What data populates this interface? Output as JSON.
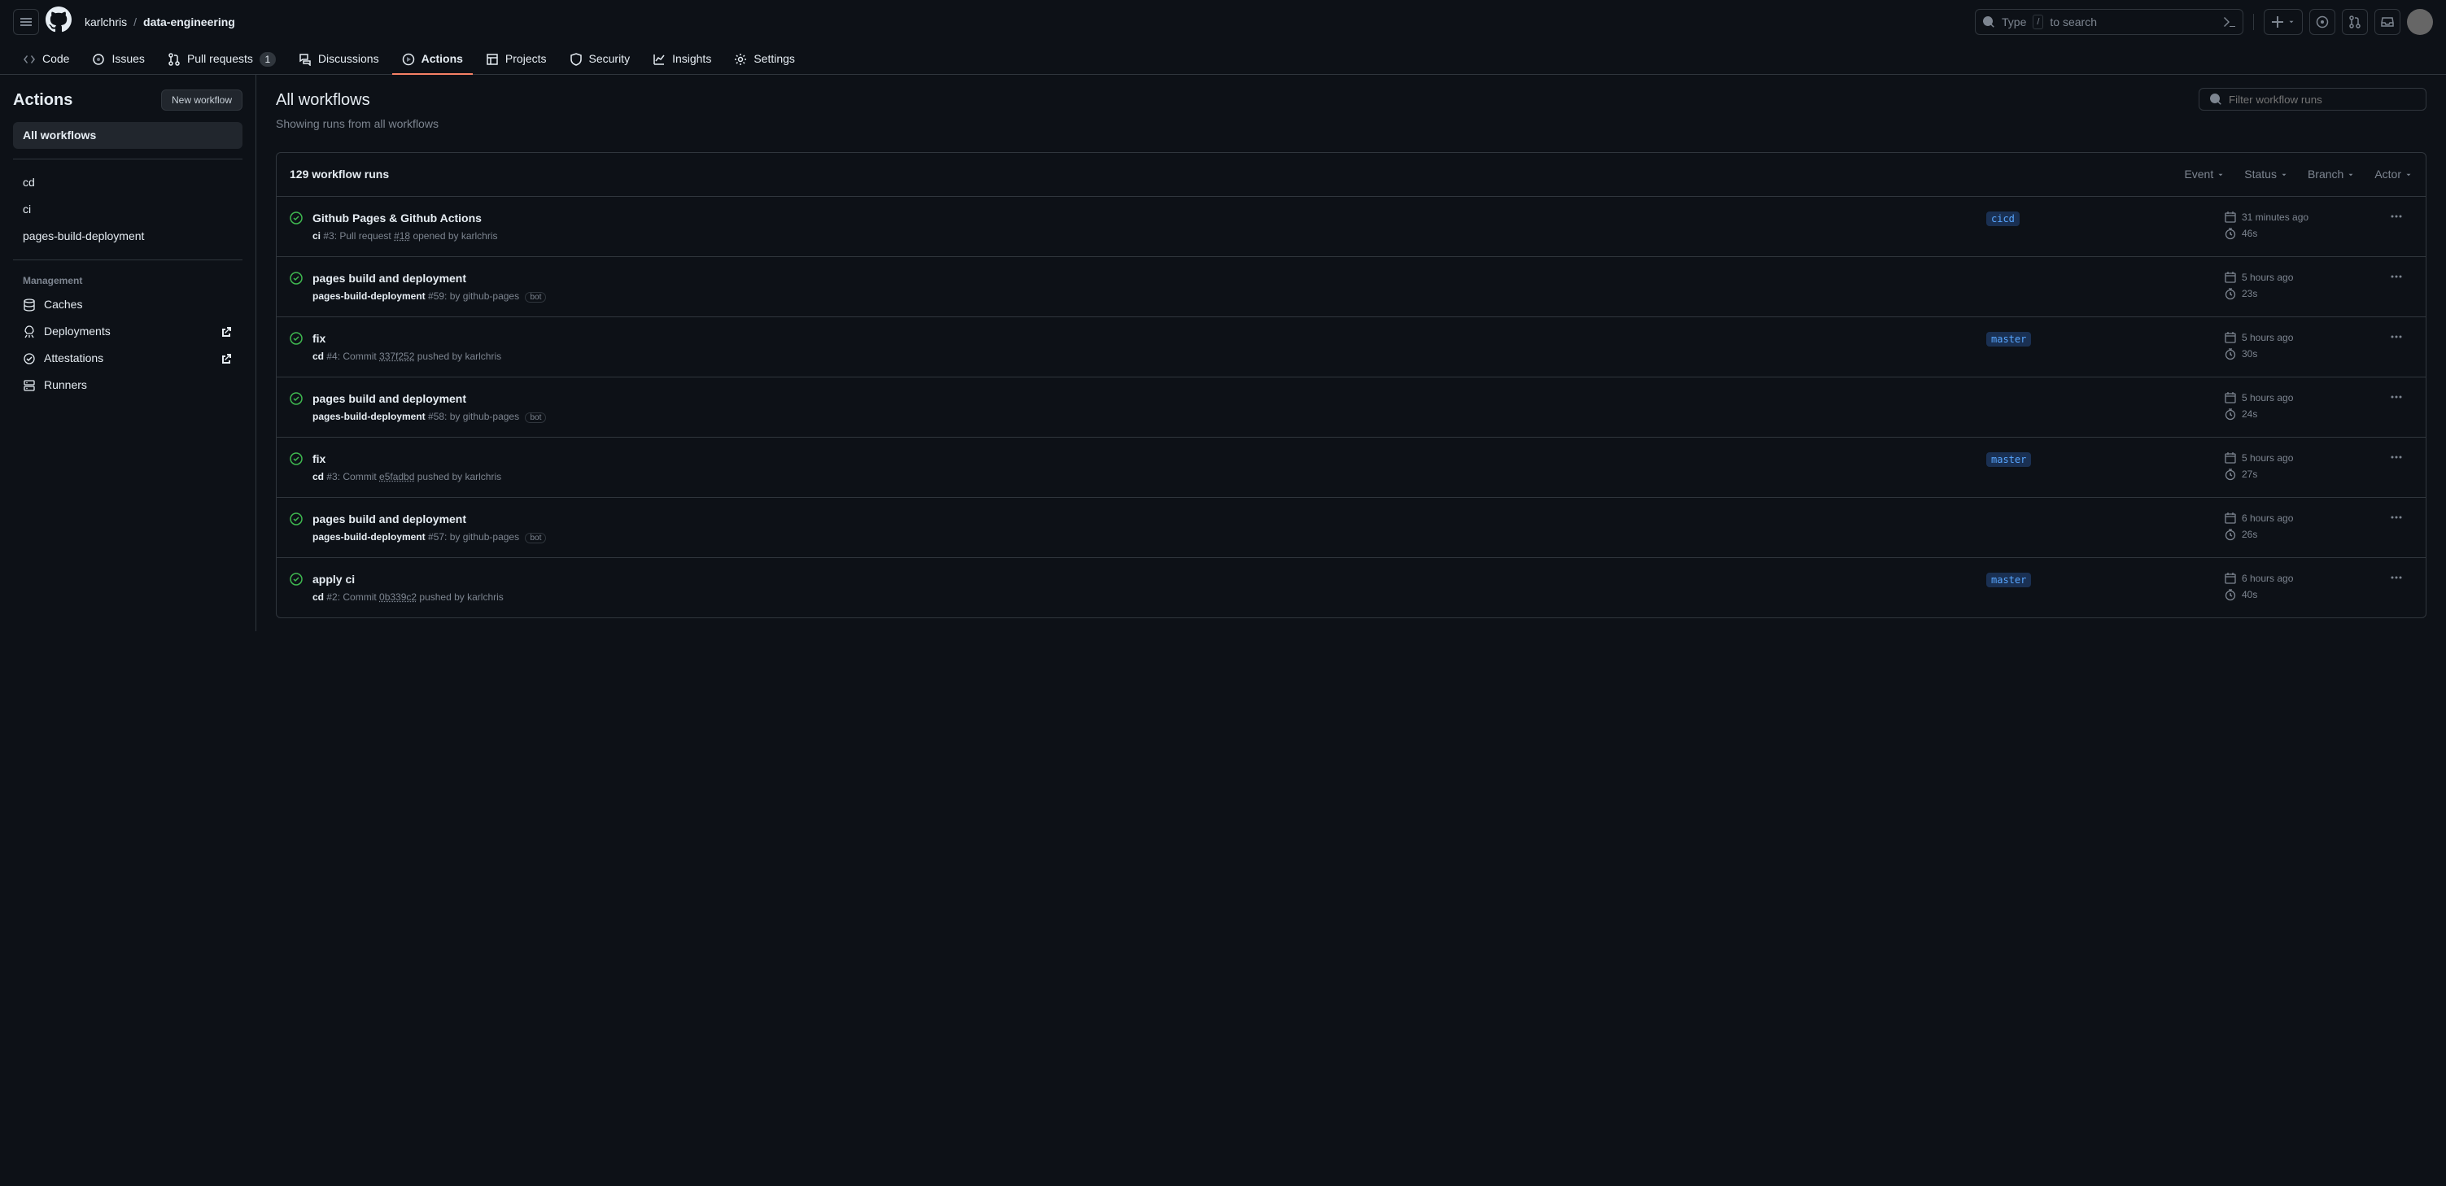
{
  "topbar": {
    "owner": "karlchris",
    "repo": "data-engineering",
    "search_prompt": "Type",
    "search_suffix": "to search",
    "search_key": "/"
  },
  "nav": {
    "code": "Code",
    "issues": "Issues",
    "pulls": "Pull requests",
    "pulls_count": "1",
    "discussions": "Discussions",
    "actions": "Actions",
    "projects": "Projects",
    "security": "Security",
    "insights": "Insights",
    "settings": "Settings"
  },
  "sidebar": {
    "title": "Actions",
    "new_workflow": "New workflow",
    "all_workflows": "All workflows",
    "workflows": [
      "cd",
      "ci",
      "pages-build-deployment"
    ],
    "management_heading": "Management",
    "caches": "Caches",
    "deployments": "Deployments",
    "attestations": "Attestations",
    "runners": "Runners"
  },
  "main": {
    "title": "All workflows",
    "subtitle": "Showing runs from all workflows",
    "filter_placeholder": "Filter workflow runs",
    "runs_count": "129 workflow runs",
    "filters": {
      "event": "Event",
      "status": "Status",
      "branch": "Branch",
      "actor": "Actor"
    }
  },
  "runs": [
    {
      "title": "Github Pages & Github Actions",
      "workflow": "ci",
      "run_id": "#3:",
      "pr_prefix": "Pull request",
      "pr": "#18",
      "action": "opened by",
      "actor": "karlchris",
      "branch": "cicd",
      "time": "31 minutes ago",
      "duration": "46s",
      "bot": false,
      "is_commit": false
    },
    {
      "title": "pages build and deployment",
      "workflow": "pages-build-deployment",
      "run_id": "#59:",
      "action": "by",
      "actor": "github-pages",
      "branch": "",
      "time": "5 hours ago",
      "duration": "23s",
      "bot": true,
      "is_commit": false
    },
    {
      "title": "fix",
      "workflow": "cd",
      "run_id": "#4:",
      "commit_prefix": "Commit",
      "commit": "337f252",
      "action": "pushed by",
      "actor": "karlchris",
      "branch": "master",
      "time": "5 hours ago",
      "duration": "30s",
      "bot": false,
      "is_commit": true
    },
    {
      "title": "pages build and deployment",
      "workflow": "pages-build-deployment",
      "run_id": "#58:",
      "action": "by",
      "actor": "github-pages",
      "branch": "",
      "time": "5 hours ago",
      "duration": "24s",
      "bot": true,
      "is_commit": false
    },
    {
      "title": "fix",
      "workflow": "cd",
      "run_id": "#3:",
      "commit_prefix": "Commit",
      "commit": "e5fadbd",
      "action": "pushed by",
      "actor": "karlchris",
      "branch": "master",
      "time": "5 hours ago",
      "duration": "27s",
      "bot": false,
      "is_commit": true
    },
    {
      "title": "pages build and deployment",
      "workflow": "pages-build-deployment",
      "run_id": "#57:",
      "action": "by",
      "actor": "github-pages",
      "branch": "",
      "time": "6 hours ago",
      "duration": "26s",
      "bot": true,
      "is_commit": false
    },
    {
      "title": "apply ci",
      "workflow": "cd",
      "run_id": "#2:",
      "commit_prefix": "Commit",
      "commit": "0b339c2",
      "action": "pushed by",
      "actor": "karlchris",
      "branch": "master",
      "time": "6 hours ago",
      "duration": "40s",
      "bot": false,
      "is_commit": true
    }
  ],
  "bot_label": "bot"
}
